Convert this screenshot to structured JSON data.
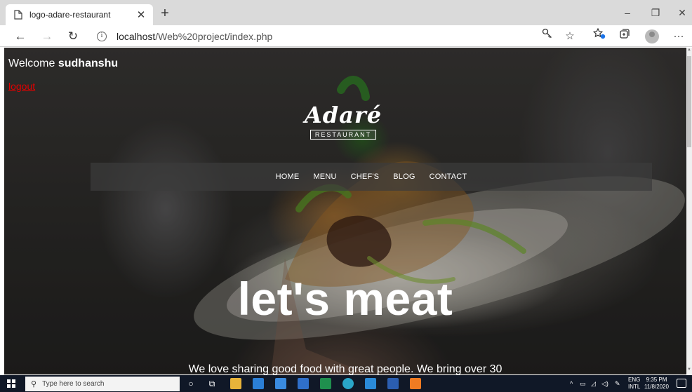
{
  "browser": {
    "tab_title": "logo-adare-restaurant",
    "tab_close": "✕",
    "new_tab": "+",
    "url_host": "localhost",
    "url_path": "/Web%20project/index.php",
    "window_controls": {
      "minimize": "–",
      "restore": "❐",
      "close": "✕"
    },
    "icons": [
      "page-icon",
      "back-icon",
      "forward-icon",
      "refresh-icon",
      "info-icon",
      "key-icon",
      "star-icon",
      "favorites-icon",
      "collections-icon",
      "profile-icon",
      "more-icon"
    ]
  },
  "page": {
    "welcome_prefix": "Welcome ",
    "username": "sudhanshu",
    "logout_label": "logout",
    "logo": {
      "name": "Adaré",
      "sub": "RESTAURANT"
    },
    "nav": [
      "HOME",
      "MENU",
      "CHEF'S",
      "BLOG",
      "CONTACT"
    ],
    "headline": "let's meat",
    "tagline": "We love sharing good food with great people. We bring over 30"
  },
  "taskbar": {
    "search_placeholder": "Type here to search",
    "lang_top": "ENG",
    "lang_bottom": "INTL",
    "time": "9:35 PM",
    "date": "11/8/2020",
    "app_icons": [
      "cortana-icon",
      "task-view-icon",
      "file-explorer-icon",
      "mail-icon",
      "store-icon",
      "calendar-icon",
      "excel-icon",
      "edge-icon",
      "vscode-icon",
      "word-icon",
      "xampp-icon"
    ]
  },
  "colors": {
    "logout": "#e00000",
    "taskbar": "#101827",
    "tabstrip": "#dadada"
  }
}
